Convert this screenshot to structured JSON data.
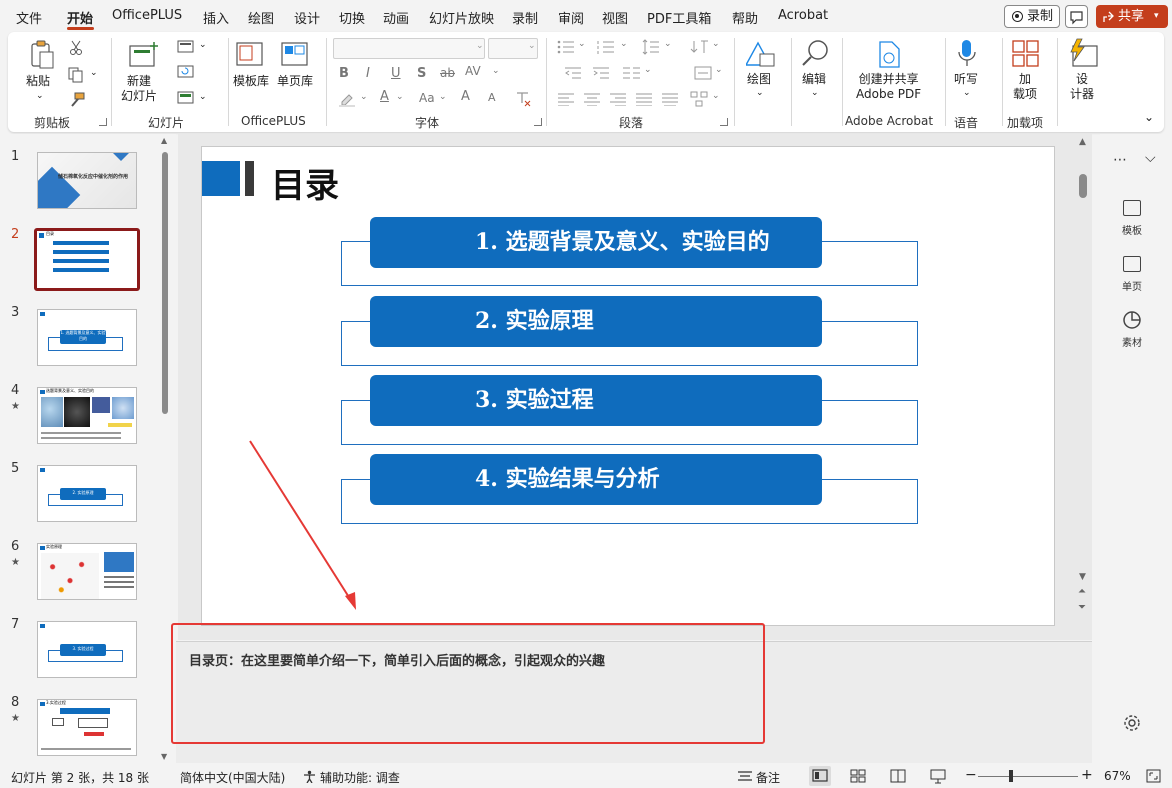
{
  "menu": {
    "items": [
      "文件",
      "开始",
      "OfficePLUS",
      "插入",
      "绘图",
      "设计",
      "切换",
      "动画",
      "幻灯片放映",
      "录制",
      "审阅",
      "视图",
      "PDF工具箱",
      "帮助",
      "Acrobat"
    ],
    "active": "开始",
    "record_label": "录制",
    "share_label": "共享",
    "accent_color": "#c43e1c"
  },
  "ribbon": {
    "clipboard": {
      "paste": "粘贴",
      "group": "剪贴板"
    },
    "slides": {
      "new_slide": "新建\n幻灯片",
      "group": "幻灯片"
    },
    "officeplus": {
      "template": "模板库",
      "single_page": "单页库",
      "group": "OfficePLUS"
    },
    "font": {
      "group": "字体",
      "buttons": [
        "B",
        "I",
        "U",
        "S",
        "ab",
        "AV",
        "A",
        "Aa",
        "A",
        "A"
      ]
    },
    "paragraph": {
      "group": "段落"
    },
    "drawing": {
      "label": "绘图"
    },
    "editing": {
      "label": "编辑"
    },
    "acrobat": {
      "label": "创建并共享\nAdobe PDF",
      "group": "Adobe Acrobat"
    },
    "voice": {
      "label": "听写",
      "group": "语音"
    },
    "addins": {
      "label": "加\n载项",
      "group": "加载项"
    },
    "designer": {
      "label": "设\n计器"
    }
  },
  "thumbnails": [
    {
      "num": "1",
      "star": false,
      "title": "储石棉氧化反应中催化剂的作用"
    },
    {
      "num": "2",
      "star": false,
      "title": "目录",
      "selected": true
    },
    {
      "num": "3",
      "star": false,
      "title": "1. 选题背景及意义、实验目的"
    },
    {
      "num": "4",
      "star": true,
      "title": "选题背景及意义、实验目的"
    },
    {
      "num": "5",
      "star": false,
      "title": "2. 实验原理"
    },
    {
      "num": "6",
      "star": true,
      "title": "实验原理"
    },
    {
      "num": "7",
      "star": false,
      "title": "3. 实验过程"
    },
    {
      "num": "8",
      "star": true,
      "title": "3.实验过程"
    }
  ],
  "slide": {
    "title": "目录",
    "items": [
      "1. 选题背景及意义、实验目的",
      "2. 实验原理",
      "3. 实验过程",
      "4. 实验结果与分析"
    ],
    "accent_color": "#0f6cbd"
  },
  "notes": {
    "text": "目录页：在这里要简单介绍一下，简单引入后面的概念，引起观众的兴趣"
  },
  "right_panel": {
    "items": [
      "模板",
      "单页",
      "素材"
    ]
  },
  "status": {
    "slide_info": "幻灯片 第 2 张，共 18 张",
    "language": "简体中文(中国大陆)",
    "accessibility": "辅助功能: 调查",
    "notes_label": "备注",
    "zoom": "67%"
  }
}
